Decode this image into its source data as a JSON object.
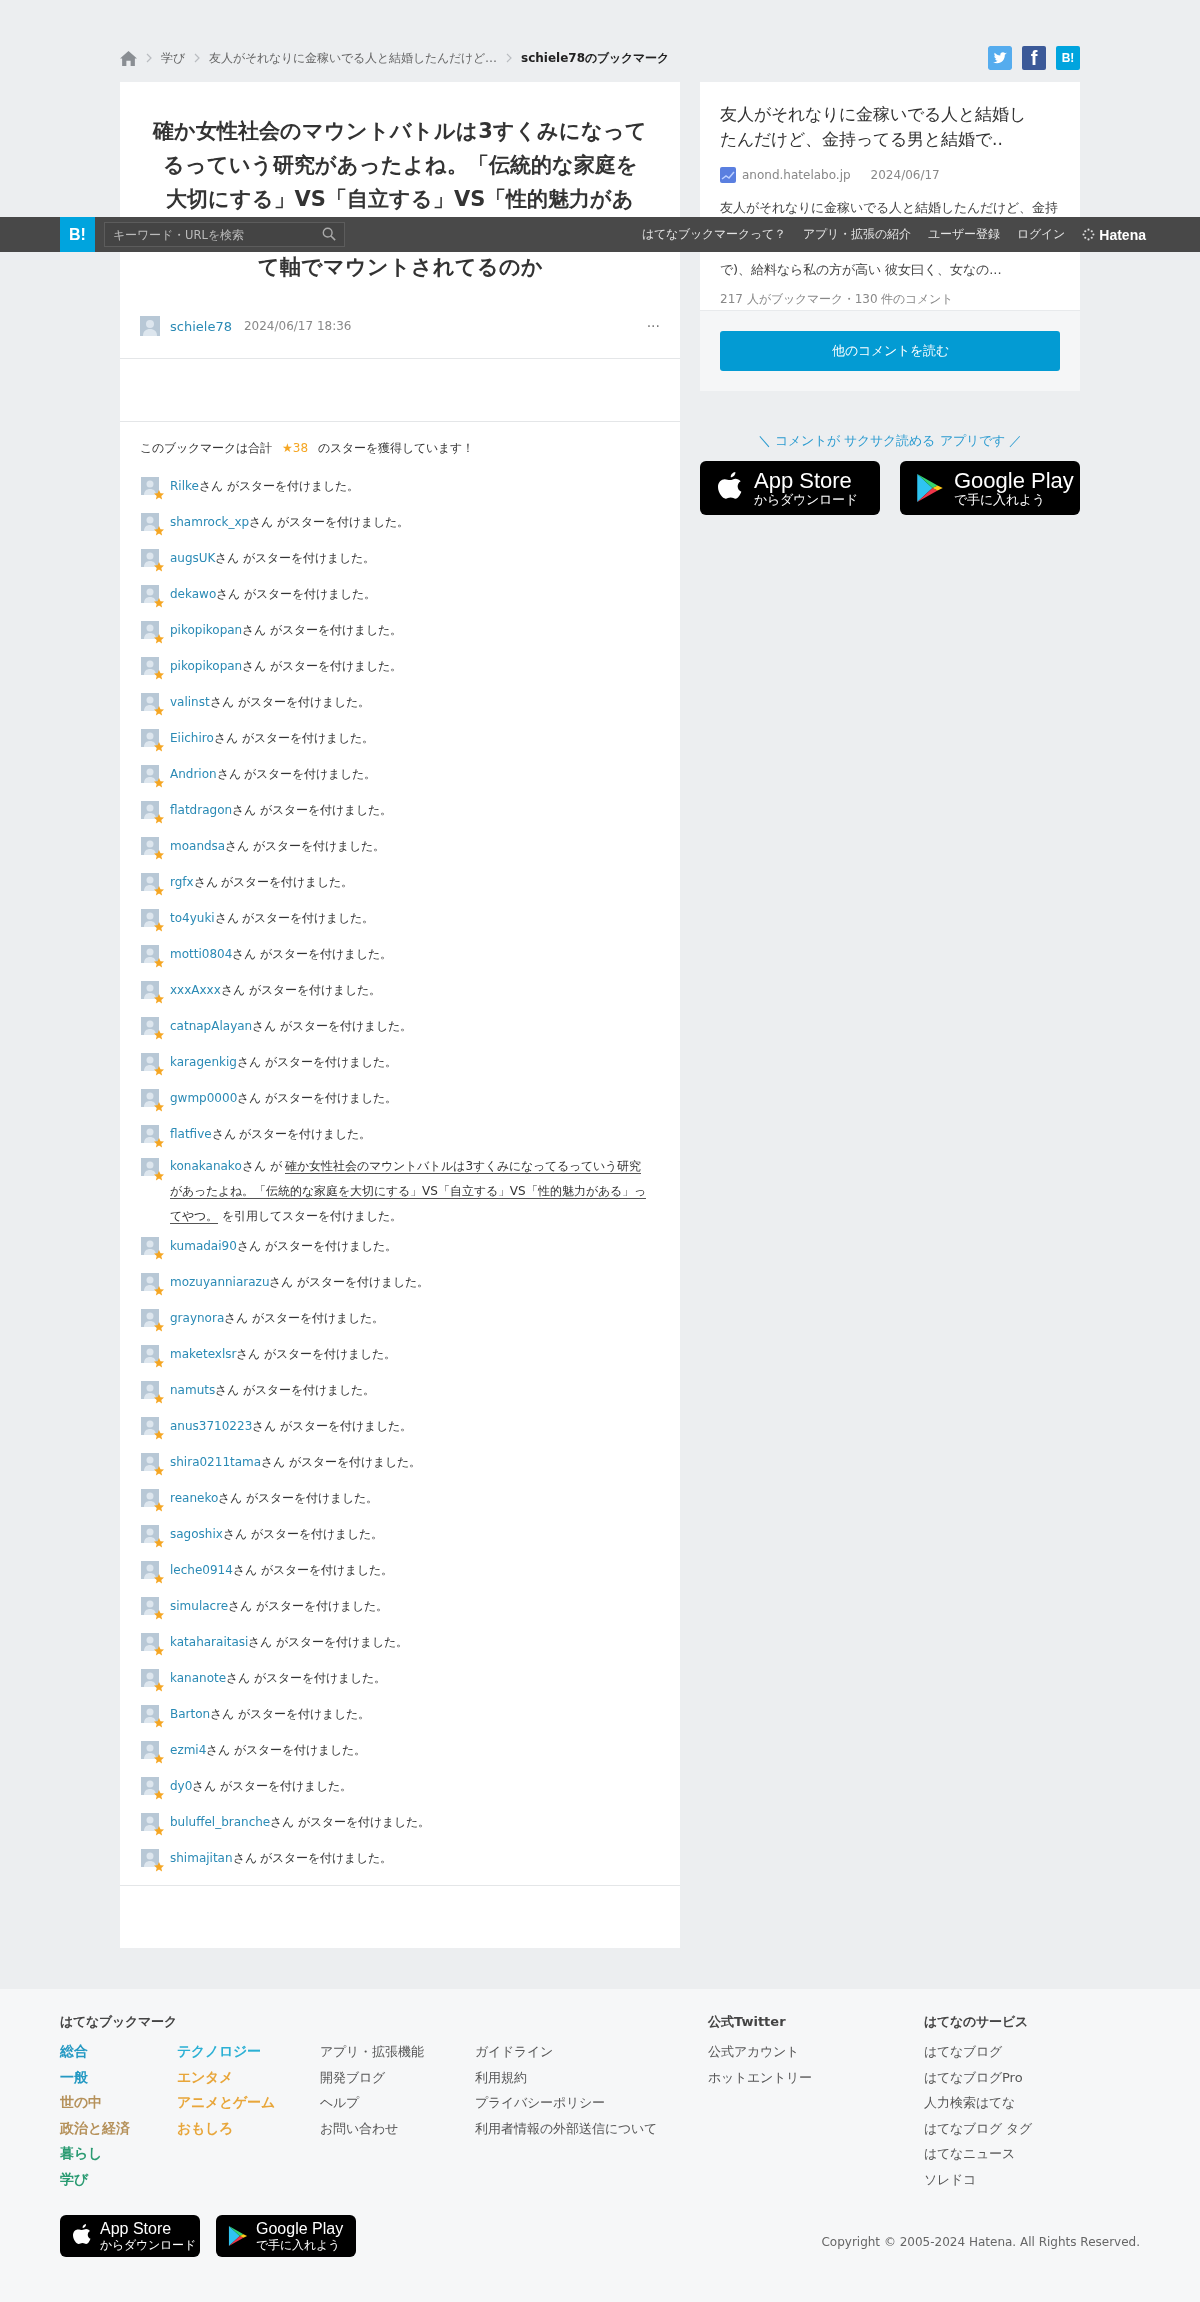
{
  "breadcrumb": {
    "items": [
      "学び",
      "友人がそれなりに金稼いでる人と結婚したんだけど…"
    ],
    "current": "schiele78のブックマーク"
  },
  "share": {
    "facebook": "f",
    "hatena": "B!"
  },
  "bookmark": {
    "title_lines": [
      "確か女性社会のマウントバトルは3すくみになって",
      "るっていう研究があったよね。「伝統的な家庭を",
      "大切にする」VS「自立する」VS「性的魅力があ",
      "て軸でマウントされてるのか"
    ],
    "user": "schiele78",
    "date": "2024/06/17 18:36",
    "menu": "···"
  },
  "stars_summary": {
    "prefix": "このブックマークは合計",
    "count": "★38",
    "suffix": "のスターを獲得しています！"
  },
  "stars": [
    {
      "kind": "plain",
      "user": "Rilke",
      "text": "さん がスターを付けました。"
    },
    {
      "kind": "plain",
      "user": "shamrock_xp",
      "text": "さん がスターを付けました。"
    },
    {
      "kind": "plain",
      "user": "augsUK",
      "text": "さん がスターを付けました。"
    },
    {
      "kind": "plain",
      "user": "dekawo",
      "text": "さん がスターを付けました。"
    },
    {
      "kind": "plain",
      "user": "pikopikopan",
      "text": "さん がスターを付けました。"
    },
    {
      "kind": "plain",
      "user": "pikopikopan",
      "text": "さん がスターを付けました。"
    },
    {
      "kind": "plain",
      "user": "valinst",
      "text": "さん がスターを付けました。"
    },
    {
      "kind": "plain",
      "user": "Eiichiro",
      "text": "さん がスターを付けました。"
    },
    {
      "kind": "plain",
      "user": "Andrion",
      "text": "さん がスターを付けました。"
    },
    {
      "kind": "plain",
      "user": "flatdragon",
      "text": "さん がスターを付けました。"
    },
    {
      "kind": "plain",
      "user": "moandsa",
      "text": "さん がスターを付けました。"
    },
    {
      "kind": "plain",
      "user": "rgfx",
      "text": "さん がスターを付けました。"
    },
    {
      "kind": "plain",
      "user": "to4yuki",
      "text": "さん がスターを付けました。"
    },
    {
      "kind": "plain",
      "user": "motti0804",
      "text": "さん がスターを付けました。"
    },
    {
      "kind": "plain",
      "user": "xxxAxxx",
      "text": "さん がスターを付けました。"
    },
    {
      "kind": "plain",
      "user": "catnapAlayan",
      "text": "さん がスターを付けました。"
    },
    {
      "kind": "plain",
      "user": "karagenkig",
      "text": "さん がスターを付けました。"
    },
    {
      "kind": "plain",
      "user": "gwmp0000",
      "text": "さん がスターを付けました。"
    },
    {
      "kind": "plain",
      "user": "flatfive",
      "text": "さん がスターを付けました。"
    },
    {
      "kind": "quote",
      "user": "konakanako",
      "text": "さん が",
      "quote": "確か女性社会のマウントバトルは3すくみになってるっていう研究があったよね。「伝統的な家庭を大切にする」VS「自立する」VS「性的魅力がある」ってやつ。",
      "after": "を引用してスターを付けました。"
    },
    {
      "kind": "plain",
      "user": "kumadai90",
      "text": "さん がスターを付けました。"
    },
    {
      "kind": "plain",
      "user": "mozuyanniarazu",
      "text": "さん がスターを付けました。"
    },
    {
      "kind": "plain",
      "user": "graynora",
      "text": "さん がスターを付けました。"
    },
    {
      "kind": "plain",
      "user": "maketexlsr",
      "text": "さん がスターを付けました。"
    },
    {
      "kind": "plain",
      "user": "namuts",
      "text": "さん がスターを付けました。"
    },
    {
      "kind": "plain",
      "user": "anus3710223",
      "text": "さん がスターを付けました。"
    },
    {
      "kind": "plain",
      "user": "shira0211tama",
      "text": "さん がスターを付けました。"
    },
    {
      "kind": "plain",
      "user": "reaneko",
      "text": "さん がスターを付けました。"
    },
    {
      "kind": "plain",
      "user": "sagoshix",
      "text": "さん がスターを付けました。"
    },
    {
      "kind": "plain",
      "user": "leche0914",
      "text": "さん がスターを付けました。"
    },
    {
      "kind": "plain",
      "user": "simulacre",
      "text": "さん がスターを付けました。"
    },
    {
      "kind": "plain",
      "user": "kataharaitasi",
      "text": "さん がスターを付けました。"
    },
    {
      "kind": "plain",
      "user": "kananote",
      "text": "さん がスターを付けました。"
    },
    {
      "kind": "plain",
      "user": "Barton",
      "text": "さん がスターを付けました。"
    },
    {
      "kind": "plain",
      "user": "ezmi4",
      "text": "さん がスターを付けました。"
    },
    {
      "kind": "plain",
      "user": "dy0",
      "text": "さん がスターを付けました。"
    },
    {
      "kind": "plain",
      "user": "buluffel_branche",
      "text": "さん がスターを付けました。"
    },
    {
      "kind": "plain",
      "user": "shimajitan",
      "text": "さん がスターを付けました。"
    }
  ],
  "entry": {
    "title_lines": [
      "友人がそれなりに金稼いでる人と結婚し",
      "たんだけど、金持ってる男と結婚で.."
    ],
    "site": "anond.hatelabo.jp",
    "date": "2024/06/17",
    "excerpt_lines": [
      "友人がそれなりに金稼いでる人と結婚したんだけど、金持",
      "で)、給料なら私の方が高い 彼女曰く、女なの..."
    ],
    "count": "217 人がブックマーク・130 件のコメント",
    "button": "他のコメントを読む"
  },
  "app_promo": {
    "label": "＼ コメントが サクサク読める アプリです ／",
    "app_store": {
      "title": "App Store",
      "sub": "からダウンロード"
    },
    "google_play": {
      "title": "Google Play",
      "sub": "で手に入れよう"
    }
  },
  "navbar": {
    "logo": "B!",
    "search": {
      "placeholder": "キーワード・URLを検索"
    },
    "links": [
      "はてなブックマークって？",
      "アプリ・拡張の紹介",
      "ユーザー登録",
      "ログイン"
    ],
    "brand": "Hatena"
  },
  "footer": {
    "title": "はてなブックマーク",
    "categories": [
      [
        {
          "label": "総合",
          "color": "#2499c3"
        },
        {
          "label": "一般",
          "color": "#2499c3"
        },
        {
          "label": "世の中",
          "color": "#b5915a"
        },
        {
          "label": "政治と経済",
          "color": "#b5915a"
        },
        {
          "label": "暮らし",
          "color": "#2a9b72"
        },
        {
          "label": "学び",
          "color": "#2a9b72"
        }
      ],
      [
        {
          "label": "テクノロジー",
          "color": "#2bb0d4"
        },
        {
          "label": "エンタメ",
          "color": "#e8a63a"
        },
        {
          "label": "アニメとゲーム",
          "color": "#e8a63a"
        },
        {
          "label": "おもしろ",
          "color": "#e8a63a"
        }
      ]
    ],
    "link_columns": [
      [
        "アプリ・拡張機能",
        "開発ブログ",
        "ヘルプ",
        "お問い合わせ"
      ],
      [
        "ガイドライン",
        "利用規約",
        "プライバシーポリシー",
        "利用者情報の外部送信について"
      ]
    ],
    "twitter": {
      "title": "公式Twitter",
      "links": [
        "公式アカウント",
        "ホットエントリー"
      ]
    },
    "services": {
      "title": "はてなのサービス",
      "links": [
        "はてなブログ",
        "はてなブログPro",
        "人力検索はてな",
        "はてなブログ タグ",
        "はてなニュース",
        "ソレドコ"
      ]
    },
    "app_store": {
      "title": "App Store",
      "sub": "からダウンロード"
    },
    "google_play": {
      "title": "Google Play",
      "sub": "で手に入れよう"
    },
    "copyright": "Copyright © 2005-2024 Hatena. All Rights Reserved."
  }
}
